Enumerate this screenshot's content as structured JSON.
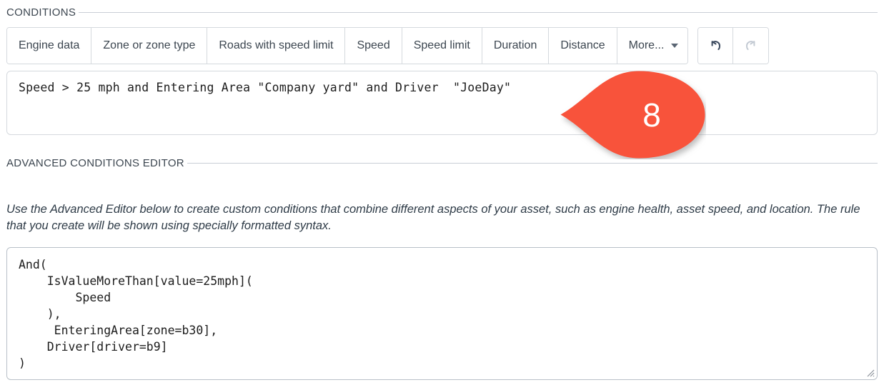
{
  "colors": {
    "callout_fill": "#f8523a",
    "border": "#d5d9de",
    "text": "#36404a",
    "undo_enabled": "#39475c",
    "redo_disabled": "#c3cad3"
  },
  "conditions_section": {
    "legend": "CONDITIONS",
    "toolbar": {
      "buttons": [
        {
          "label": "Engine data",
          "name": "engine-data"
        },
        {
          "label": "Zone or zone type",
          "name": "zone-or-zone-type"
        },
        {
          "label": "Roads with speed limit",
          "name": "roads-with-speed-limit"
        },
        {
          "label": "Speed",
          "name": "speed"
        },
        {
          "label": "Speed limit",
          "name": "speed-limit"
        },
        {
          "label": "Duration",
          "name": "duration"
        },
        {
          "label": "Distance",
          "name": "distance"
        },
        {
          "label": "More...",
          "name": "more"
        }
      ],
      "undo_title": "Undo",
      "redo_title": "Redo"
    },
    "expression": "Speed > 25 mph and Entering Area \"Company yard\" and Driver  \"JoeDay\""
  },
  "callout": {
    "number": "8"
  },
  "advanced_section": {
    "legend": "ADVANCED CONDITIONS EDITOR",
    "description": "Use the Advanced Editor below to create custom conditions that combine different aspects of your asset, such as engine health, asset speed, and location. The rule that you create will be shown using specially formatted syntax.",
    "code": "And(\n    IsValueMoreThan[value=25mph](\n        Speed\n    ),\n     EnteringArea[zone=b30],\n    Driver[driver=b9]\n)"
  }
}
